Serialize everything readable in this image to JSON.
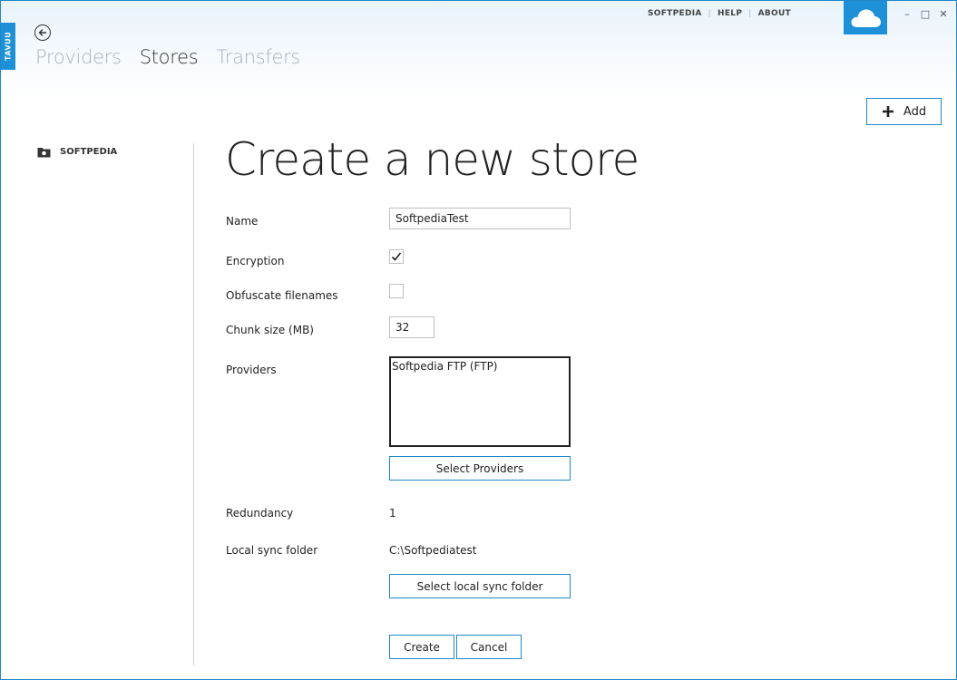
{
  "app": {
    "brand_tab": "TAVUU"
  },
  "toplinks": [
    "SOFTPEDIA",
    "HELP",
    "ABOUT"
  ],
  "window_controls": {
    "minimize": "–",
    "maximize": "□",
    "close": "✕"
  },
  "nav": {
    "tabs": [
      {
        "label": "Providers",
        "active": false
      },
      {
        "label": "Stores",
        "active": true
      },
      {
        "label": "Transfers",
        "active": false
      }
    ]
  },
  "toolbar": {
    "add_label": "Add"
  },
  "sidebar": {
    "items": [
      {
        "label": "SOFTPEDIA",
        "icon": "store-folder-icon"
      }
    ]
  },
  "form": {
    "title": "Create a new store",
    "name_label": "Name",
    "name_value": "SoftpediaTest",
    "encryption_label": "Encryption",
    "encryption_checked": true,
    "obfuscate_label": "Obfuscate filenames",
    "obfuscate_checked": false,
    "chunk_label": "Chunk size (MB)",
    "chunk_value": "32",
    "providers_label": "Providers",
    "providers_items": [
      "Softpedia FTP (FTP)"
    ],
    "select_providers_label": "Select Providers",
    "redundancy_label": "Redundancy",
    "redundancy_value": "1",
    "sync_label": "Local sync folder",
    "sync_value": "C:\\Softpediatest",
    "select_sync_label": "Select local sync folder",
    "create_label": "Create",
    "cancel_label": "Cancel"
  },
  "colors": {
    "accent": "#1e90d8",
    "border_accent": "#1e88c8"
  }
}
